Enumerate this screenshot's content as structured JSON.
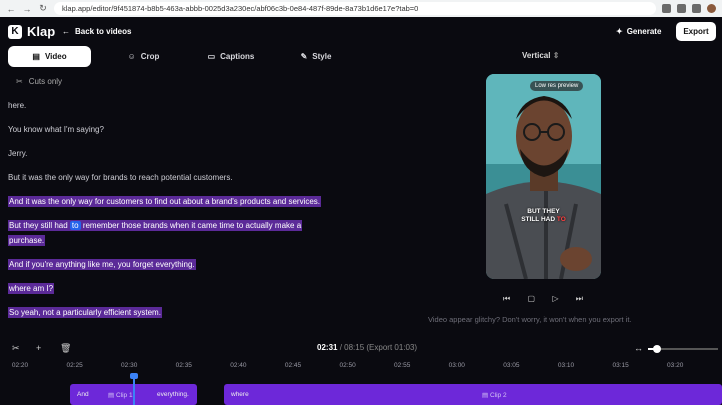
{
  "browser": {
    "url": "klap.app/editor/9f451874-b8b5-463a-abbb-0025d3a230ec/abf06c3b-0e84-487f-89de-8a73b1d6e17e?tab=0"
  },
  "header": {
    "logo": "Klap",
    "back_label": "Back to videos",
    "generate_label": "Generate",
    "export_label": "Export"
  },
  "tabs": [
    {
      "label": "Video",
      "active": true
    },
    {
      "label": "Crop",
      "active": false
    },
    {
      "label": "Captions",
      "active": false
    },
    {
      "label": "Style",
      "active": false
    }
  ],
  "aspect": {
    "label": "Vertical"
  },
  "cuts": {
    "label": "Cuts only"
  },
  "transcript": [
    {
      "text": "here.",
      "highlight": false
    },
    {
      "text": "You know what I'm saying?",
      "highlight": false
    },
    {
      "text": "Jerry.",
      "highlight": false
    },
    {
      "text": "But it was the only way for brands to reach potential customers.",
      "highlight": false
    },
    {
      "text": "And it was the only way for customers to find out about a brand's products and services.",
      "highlight": true
    },
    {
      "pre": "But they still had ",
      "selected": "to",
      "post": " remember those brands when it came time to actually make a",
      "highlight": true
    },
    {
      "text": "purchase.",
      "highlight": true
    },
    {
      "text": "And if you're anything like me, you forget everything.",
      "highlight": true
    },
    {
      "text": "where am I?",
      "highlight": true
    },
    {
      "text": "So yeah, not a particularly efficient system.",
      "highlight": true
    }
  ],
  "preview": {
    "badge": "Low res preview",
    "caption_line1": "BUT THEY",
    "caption_line2_white": "STILL HAD ",
    "caption_line2_red": "TO",
    "glitch_note": "Video appear glitchy? Don't worry, it won't when you export it."
  },
  "timeline": {
    "current": "02:31",
    "total_label": " / 08:15 (Export 01:03)",
    "zoom_level": 0.13,
    "ticks": [
      "02:20",
      "02:25",
      "02:30",
      "02:35",
      "02:40",
      "02:45",
      "02:50",
      "02:55",
      "03:00",
      "03:05",
      "03:10",
      "03:15",
      "03:20"
    ],
    "clip1": {
      "word_start": "And",
      "label": "Clip 1",
      "word_end": "everything."
    },
    "clip2": {
      "word_start": "where",
      "label": "Clip 2"
    }
  },
  "colors": {
    "accent": "#6d28d9",
    "highlight": "#5b2a98",
    "playhead": "#3b82f6"
  }
}
